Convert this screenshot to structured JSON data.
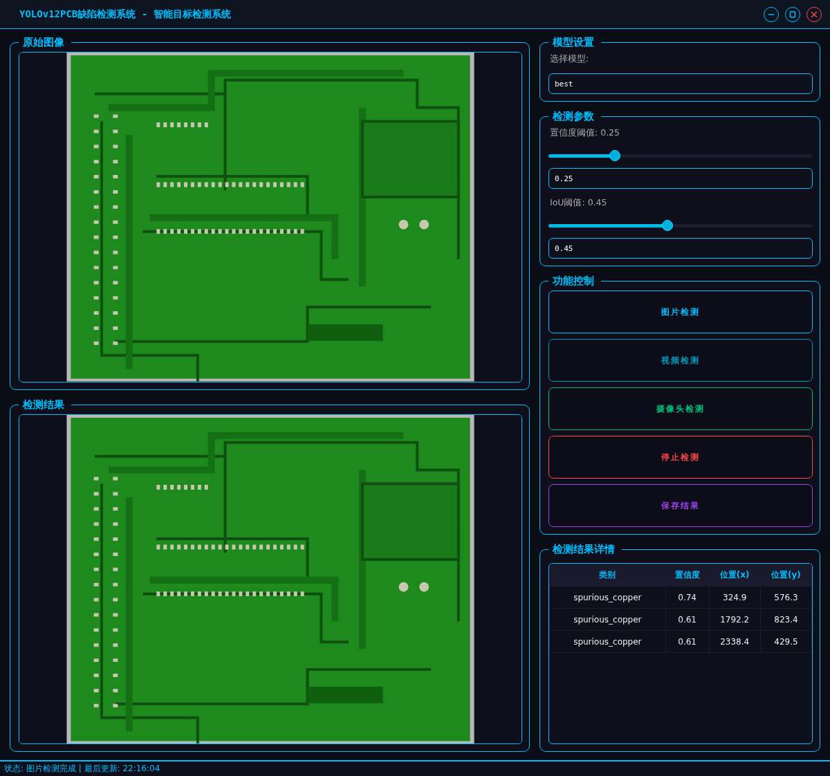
{
  "window": {
    "title": "YOLOv12PCB缺陷检测系统 - 智能目标检测系统"
  },
  "image_panels": [
    {
      "title": "原始图像"
    },
    {
      "title": "检测结果"
    }
  ],
  "model_settings": {
    "title": "模型设置",
    "label": "选择模型:",
    "value": "best"
  },
  "parameters": {
    "title": "检测参数",
    "sliders": [
      {
        "label": "置信度阈值: 0.25",
        "level": 0.25,
        "value": "0.25"
      },
      {
        "label": "IoU阈值: 0.45",
        "level": 0.45,
        "value": "0.45"
      }
    ]
  },
  "controls": {
    "title": "功能控制",
    "buttons": [
      {
        "label": "图片检测",
        "color": "#00bfff"
      },
      {
        "label": "视频检测",
        "color": "#0099bb"
      },
      {
        "label": "摄像头检测",
        "color": "#00c080"
      },
      {
        "label": "停止检测",
        "color": "#ff4444"
      },
      {
        "label": "保存结果",
        "color": "#9944ee"
      }
    ]
  },
  "results": {
    "title": "检测结果详情",
    "columns": [
      "类别",
      "置信度",
      "位置(x)",
      "位置(y)"
    ],
    "rows": [
      [
        "spurious_copper",
        "0.74",
        "324.9",
        "576.3"
      ],
      [
        "spurious_copper",
        "0.61",
        "1792.2",
        "823.4"
      ],
      [
        "spurious_copper",
        "0.61",
        "2338.4",
        "429.5"
      ]
    ]
  },
  "status_bar": "状态: 图片检测完成 | 最后更新: 22:16:04"
}
